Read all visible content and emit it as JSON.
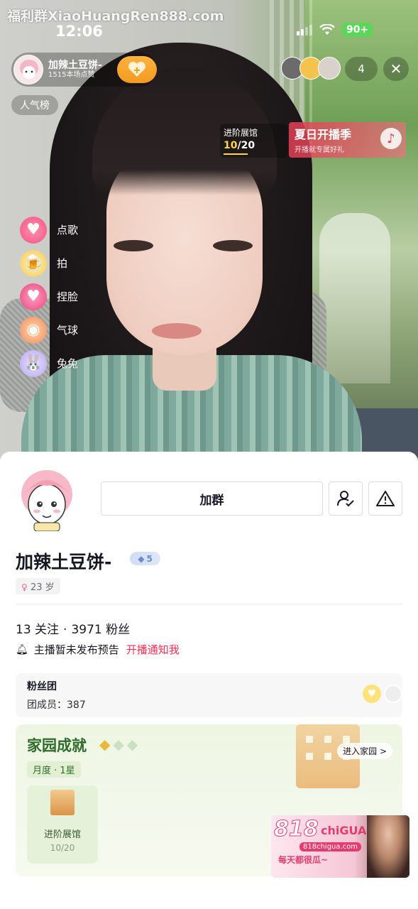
{
  "watermark": "福利群XiaoHuangRen888.com",
  "status_bar": {
    "time": "12:06",
    "battery": "90+"
  },
  "live": {
    "host_name": "加辣土豆饼-",
    "host_likes": "1515本场点赞",
    "popular_label": "人气榜",
    "viewer_count": "4",
    "advance_hall": {
      "title": "进阶展馆",
      "progress_current": "10",
      "progress_sep_total": "/20"
    },
    "summer_banner": {
      "title": "夏日开播季",
      "subtitle": "开播就专属好礼"
    },
    "interactions": [
      {
        "label": "点歌",
        "icon": "heart-icon"
      },
      {
        "label": "拍",
        "icon": "beer-icon"
      },
      {
        "label": "捏脸",
        "icon": "heart-face-icon"
      },
      {
        "label": "气球",
        "icon": "balloon-icon"
      },
      {
        "label": "兔兔",
        "icon": "bunny-icon"
      }
    ]
  },
  "profile": {
    "join_button": "加群",
    "name": "加辣土豆饼-",
    "level": "5",
    "age": "23 岁",
    "following_count": "13",
    "following_label": "关注",
    "dot": "·",
    "followers_count": "3971",
    "followers_label": "粉丝",
    "notice_text": "主播暂未发布预告",
    "notice_link": "开播通知我",
    "fan_club": {
      "title": "粉丝团",
      "members": "团成员：387"
    },
    "home": {
      "title": "家园成就",
      "enter": "进入家园 >",
      "period": "月度 · 1星",
      "item_name": "进阶展馆",
      "item_count": "10/20",
      "stars_filled": 1,
      "stars_total": 3
    }
  },
  "ad": {
    "brand": "818",
    "brand2": "chiGUA",
    "site": "818chigua.com",
    "slogan": "每天都很瓜~"
  }
}
